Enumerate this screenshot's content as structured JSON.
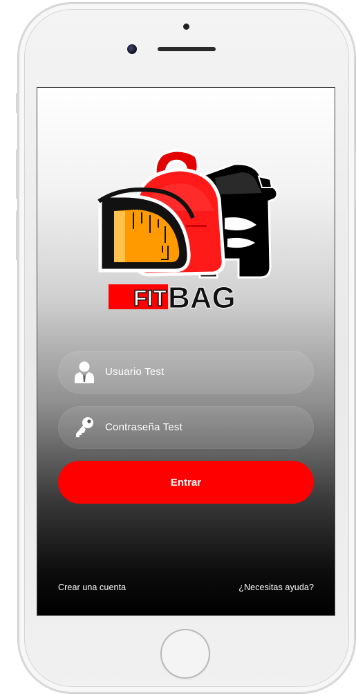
{
  "device": {
    "model": "iphone",
    "color": "#f2f2f2"
  },
  "app": {
    "logo": {
      "icon": "fitbag-logo",
      "word_fit": "FIT",
      "word_bag": "BAG",
      "brand_red": "#ff0000"
    }
  },
  "login": {
    "username": {
      "icon": "user-icon",
      "value": "Usuario Test"
    },
    "password": {
      "icon": "key-icon",
      "value": "Contraseña Test"
    },
    "submit_label": "Entrar"
  },
  "footer": {
    "create_account": "Crear una cuenta",
    "help": "¿Necesitas ayuda?"
  }
}
